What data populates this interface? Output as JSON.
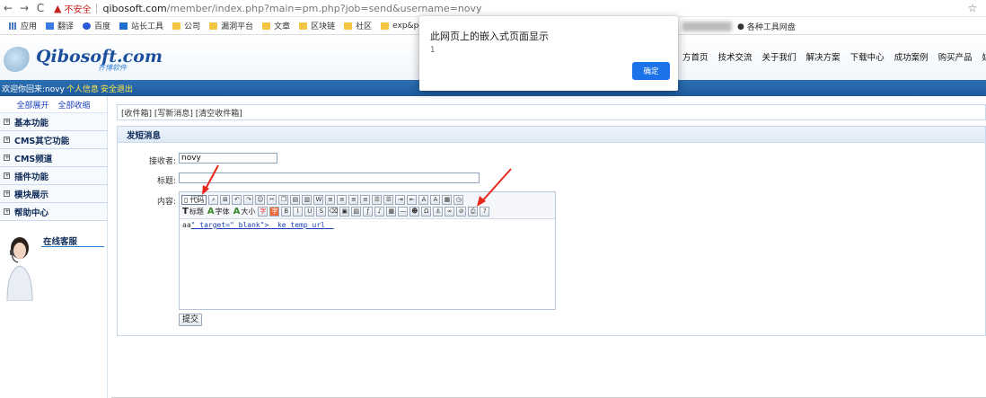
{
  "browser": {
    "security_label": "不安全",
    "url_host": "qibosoft.com",
    "url_path": "/member/index.php?main=pm.php?job=send&username=novy",
    "bookmarks": [
      "应用",
      "翻译",
      "百度",
      "站长工具",
      "公司",
      "漏洞平台",
      "文章",
      "区块链",
      "社区",
      "exp&poc"
    ],
    "bookmark_right": "各种工具网盘"
  },
  "header": {
    "logo": "Qibosoft.com",
    "logo_sub": "齐博软件",
    "nav": [
      "方首页",
      "技术交流",
      "关于我们",
      "解决方案",
      "下载中心",
      "成功案例",
      "购买产品",
      "媒体"
    ]
  },
  "userbar": {
    "welcome": "欢迎你回来:novy",
    "profile": "个人信息",
    "logout": "安全退出"
  },
  "sidebar": {
    "expand_all": "全部展开",
    "collapse_all": "全部收缩",
    "items": [
      "基本功能",
      "CMS其它功能",
      "CMS频道",
      "插件功能",
      "模块展示",
      "帮助中心"
    ],
    "support_title": "在线客服"
  },
  "main": {
    "tabs_text": "[收件箱] [写新消息] [清空收件箱]",
    "form_title": "发短消息",
    "recipient_label": "接收者:",
    "recipient_value": "novy",
    "subject_label": "标题:",
    "subject_value": "",
    "content_label": "内容:",
    "toolbar_code": "代码",
    "toolbar_title": "标题",
    "toolbar_font": "字体",
    "toolbar_size": "大小",
    "editor_prefix": "aa",
    "editor_link": "\" target=\"_blank\">__ke_temp_url__",
    "submit_label": "提交"
  },
  "dialog": {
    "title": "此网页上的嵌入式页面显示",
    "message": "1",
    "ok_label": "确定"
  },
  "colors": {
    "accent_blue": "#1d5a9c",
    "dialog_button": "#1a73e8",
    "arrow_red": "#e8261b"
  }
}
